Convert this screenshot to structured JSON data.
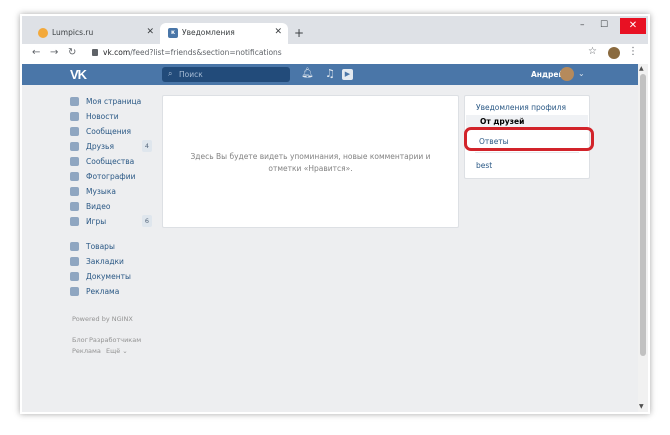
{
  "browser": {
    "tabs": [
      {
        "title": "Lumpics.ru",
        "active": false
      },
      {
        "title": "Уведомления",
        "active": true
      }
    ],
    "new_tab": "+",
    "minimize": "–",
    "maximize": "☐",
    "close": "✕",
    "url_host": "vk.com",
    "url_path": "/feed?list=friends&section=notifications"
  },
  "vk": {
    "logo": "VK",
    "search_placeholder": "Поиск",
    "user_name": "Андрей",
    "sidebar": [
      {
        "label": "Моя страница",
        "icon": "home-icon"
      },
      {
        "label": "Новости",
        "icon": "news-icon"
      },
      {
        "label": "Сообщения",
        "icon": "messages-icon"
      },
      {
        "label": "Друзья",
        "icon": "friends-icon",
        "count": "4"
      },
      {
        "label": "Сообщества",
        "icon": "groups-icon"
      },
      {
        "label": "Фотографии",
        "icon": "photos-icon"
      },
      {
        "label": "Музыка",
        "icon": "music-icon"
      },
      {
        "label": "Видео",
        "icon": "video-icon"
      },
      {
        "label": "Игры",
        "icon": "games-icon",
        "count": "6"
      }
    ],
    "sidebar2": [
      {
        "label": "Товары",
        "icon": "goods-icon"
      },
      {
        "label": "Закладки",
        "icon": "bookmarks-icon"
      },
      {
        "label": "Документы",
        "icon": "documents-icon"
      },
      {
        "label": "Реклама",
        "icon": "ads-icon"
      }
    ],
    "powered": "Powered by NGINX",
    "footer": {
      "blog": "Блог",
      "developers": "Разработчикам",
      "ads": "Реклама",
      "more": "Ещё ⌄"
    },
    "empty_line1": "Здесь Вы будете видеть упоминания, новые комментарии и",
    "empty_line2": "отметки «Нравится».",
    "filters": {
      "header": "Уведомления профиля",
      "from_friends": "От друзей",
      "replies": "Ответы",
      "best": "best"
    }
  },
  "colors": {
    "vk_blue": "#4a76a8",
    "highlight": "#d2232a"
  }
}
